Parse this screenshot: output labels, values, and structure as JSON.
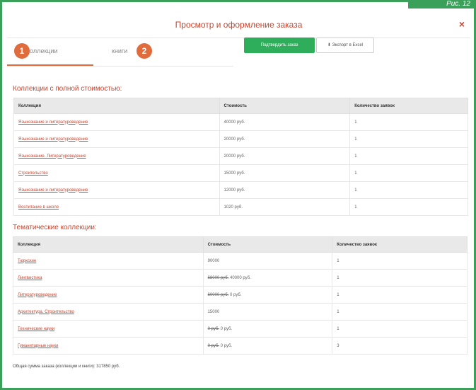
{
  "figure_tag": "Рис. 12",
  "modal": {
    "title": "Просмотр и оформление заказа",
    "close": "×"
  },
  "tabs": [
    {
      "label": "коллекции",
      "badge": "1"
    },
    {
      "label": "книги",
      "badge": "2"
    }
  ],
  "buttons": {
    "confirm": "Подтвердить заказ",
    "export": "Экспорт в Excel"
  },
  "full_price": {
    "title": "Коллекции с полной стоимостью:",
    "headers": [
      "Коллекция",
      "Стоимость",
      "Количество заявок"
    ],
    "rows": [
      [
        "Языкознание и литературоведение",
        "40000 руб.",
        "1"
      ],
      [
        "Языкознание и литературоведение",
        "20000 руб.",
        "1"
      ],
      [
        "Языкознание. Литературоведение",
        "20000 руб.",
        "1"
      ],
      [
        "Строительство",
        "15000 руб.",
        "1"
      ],
      [
        "Языкознание и литературоведение",
        "12000 руб.",
        "1"
      ],
      [
        "Воспитание в школе",
        "1020 руб.",
        "1"
      ]
    ]
  },
  "thematic": {
    "title": "Тематические коллекции:",
    "headers": [
      "Коллекция",
      "Стоимость",
      "Количество заявок"
    ],
    "rows": [
      [
        "Тюркские",
        "",
        "90000",
        "1"
      ],
      [
        "Лингвистика",
        "68000 руб.",
        "40000 руб.",
        "1"
      ],
      [
        "Литературоведение",
        "60000 руб.",
        "0 руб.",
        "1"
      ],
      [
        "Архитектура. Строительство",
        "",
        "15000",
        "1"
      ],
      [
        "Технические науки",
        "0 руб.",
        "0 руб.",
        "1"
      ],
      [
        "Гуманитарные науки",
        "0 руб.",
        "0 руб.",
        "3"
      ]
    ]
  },
  "total": "Общая сумма заказа (коллекции и книги): 317850 руб."
}
